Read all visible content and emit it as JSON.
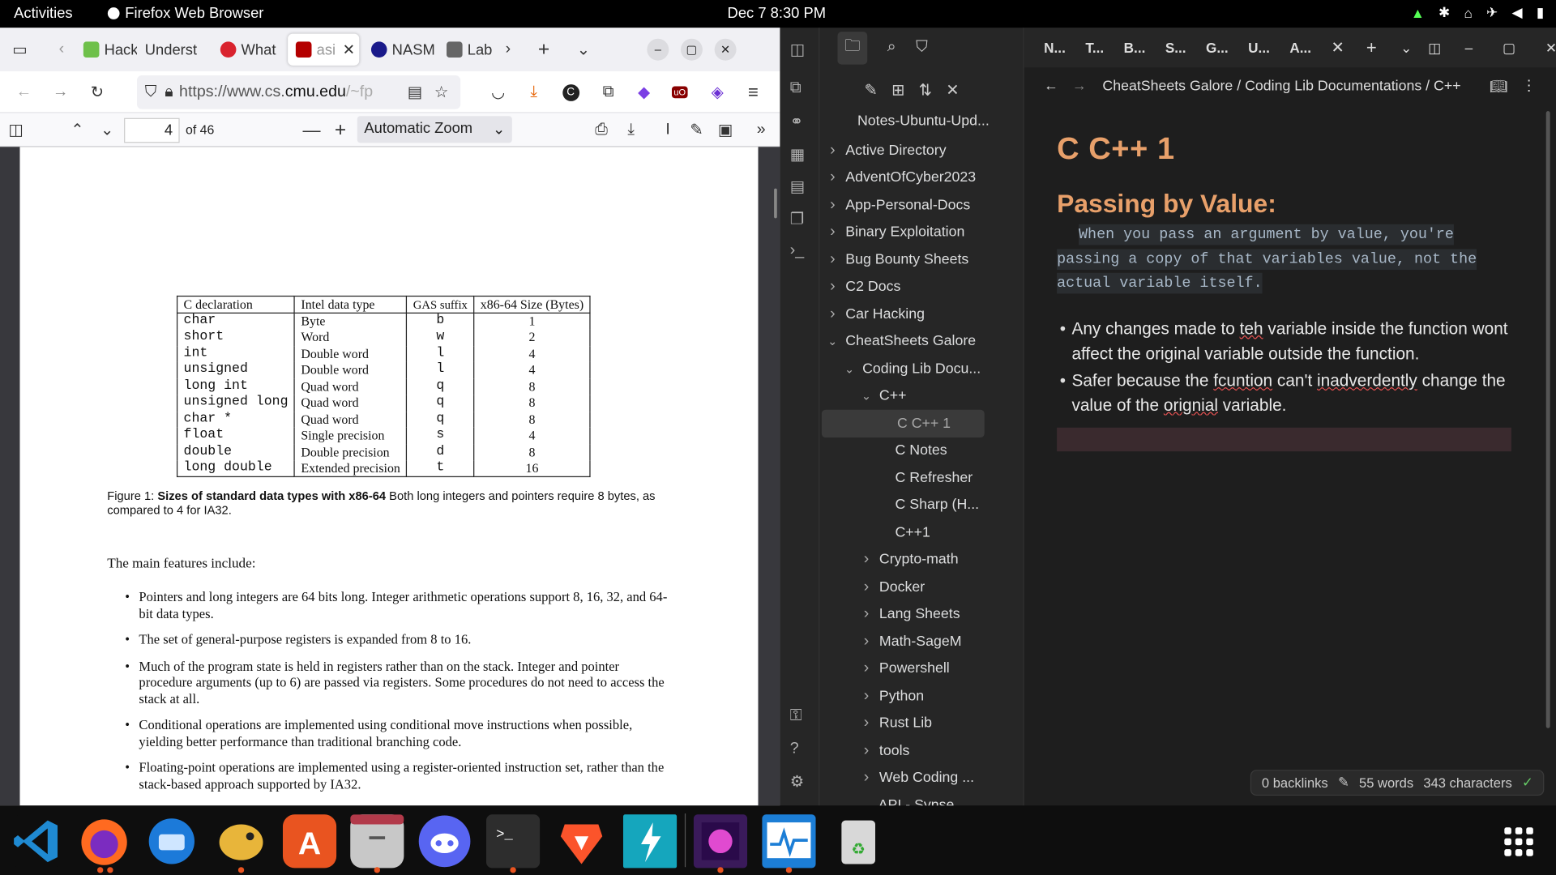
{
  "topbar": {
    "activities": "Activities",
    "app_name": "Firefox Web Browser",
    "clock": "Dec 7  8:30 PM"
  },
  "firefox": {
    "tabs": [
      {
        "label": "Hack",
        "icon_color": "#6ec04a"
      },
      {
        "label": "Underst",
        "icon_color": ""
      },
      {
        "label": "What",
        "icon_color": "#d9232e"
      },
      {
        "label": "asi",
        "icon_color": "#b40000"
      },
      {
        "label": "NASM",
        "icon_color": "#1a1a8a"
      },
      {
        "label": "Lab",
        "icon_color": "#555"
      }
    ],
    "url_prefix": "https://www.cs.",
    "url_domain": "cmu.edu",
    "url_suffix": "/~fp",
    "pdf": {
      "page_number": "4",
      "page_count": "of 46",
      "zoom": "Automatic Zoom"
    }
  },
  "pdf_content": {
    "table_headers": [
      "C declaration",
      "Intel data type",
      "GAS suffix",
      "x86-64 Size (Bytes)"
    ],
    "table_rows": [
      [
        "char",
        "Byte",
        "b",
        "1"
      ],
      [
        "short",
        "Word",
        "w",
        "2"
      ],
      [
        "int",
        "Double word",
        "l",
        "4"
      ],
      [
        "unsigned",
        "Double word",
        "l",
        "4"
      ],
      [
        "long int",
        "Quad word",
        "q",
        "8"
      ],
      [
        "unsigned long",
        "Quad word",
        "q",
        "8"
      ],
      [
        "char *",
        "Quad word",
        "q",
        "8"
      ],
      [
        "float",
        "Single precision",
        "s",
        "4"
      ],
      [
        "double",
        "Double precision",
        "d",
        "8"
      ],
      [
        "long double",
        "Extended precision",
        "t",
        "16"
      ]
    ],
    "caption_label": "Figure 1:",
    "caption_bold": "Sizes of standard data types with x86-64",
    "caption_text": "Both long integers and pointers require 8 bytes, as compared to 4 for IA32.",
    "features_intro": "The main features include:",
    "bullets": [
      "Pointers and long integers are 64 bits long. Integer arithmetic operations support 8, 16, 32, and 64-bit data types.",
      "The set of general-purpose registers is expanded from 8 to 16.",
      "Much of the program state is held in registers rather than on the stack. Integer and pointer procedure arguments (up to 6) are passed via registers. Some procedures do not need to access the stack at all.",
      "Conditional operations are implemented using conditional move instructions when possible, yielding better performance than traditional branching code.",
      "Floating-point operations are implemented using a register-oriented instruction set, rather than the stack-based approach supported by IA32."
    ]
  },
  "obsidian": {
    "vault_name": "Notes-Ubuntu-Upd...",
    "tree": [
      {
        "label": "Active Directory",
        "level": 0,
        "folder": true,
        "open": false
      },
      {
        "label": "AdventOfCyber2023",
        "level": 0,
        "folder": true,
        "open": false
      },
      {
        "label": "App-Personal-Docs",
        "level": 0,
        "folder": true,
        "open": false
      },
      {
        "label": "Binary Exploitation",
        "level": 0,
        "folder": true,
        "open": false
      },
      {
        "label": "Bug Bounty Sheets",
        "level": 0,
        "folder": true,
        "open": false
      },
      {
        "label": "C2 Docs",
        "level": 0,
        "folder": true,
        "open": false
      },
      {
        "label": "Car Hacking",
        "level": 0,
        "folder": true,
        "open": false
      },
      {
        "label": "CheatSheets Galore",
        "level": 0,
        "folder": true,
        "open": true
      },
      {
        "label": "Coding Lib Docu...",
        "level": 1,
        "folder": true,
        "open": true
      },
      {
        "label": "C++",
        "level": 2,
        "folder": true,
        "open": true
      },
      {
        "label": "C C++ 1",
        "level": 3,
        "folder": false,
        "selected": true
      },
      {
        "label": "C Notes",
        "level": 3,
        "folder": false
      },
      {
        "label": "C Refresher",
        "level": 3,
        "folder": false
      },
      {
        "label": "C Sharp (H...",
        "level": 3,
        "folder": false
      },
      {
        "label": "C++1",
        "level": 3,
        "folder": false
      },
      {
        "label": "Crypto-math",
        "level": 2,
        "folder": true,
        "open": false
      },
      {
        "label": "Docker",
        "level": 2,
        "folder": true,
        "open": false
      },
      {
        "label": "Lang Sheets",
        "level": 2,
        "folder": true,
        "open": false
      },
      {
        "label": "Math-SageM",
        "level": 2,
        "folder": true,
        "open": false
      },
      {
        "label": "Powershell",
        "level": 2,
        "folder": true,
        "open": false
      },
      {
        "label": "Python",
        "level": 2,
        "folder": true,
        "open": false
      },
      {
        "label": "Rust Lib",
        "level": 2,
        "folder": true,
        "open": false
      },
      {
        "label": "tools",
        "level": 2,
        "folder": true,
        "open": false
      },
      {
        "label": "Web Coding ...",
        "level": 2,
        "folder": true,
        "open": false
      },
      {
        "label": "API - Synse...",
        "level": 2,
        "folder": false
      }
    ],
    "editor_tabs": [
      "N...",
      "T...",
      "B...",
      "S...",
      "G...",
      "U...",
      "A..."
    ],
    "breadcrumb": [
      "CheatSheets Galore",
      "Coding Lib Documentations",
      "C++"
    ],
    "note_title": "C C++ 1",
    "heading": "Passing by Value:",
    "quote_lines": [
      "When you pass an argument by value, you're",
      "passing a copy of that variables value, not the",
      "actual variable itself."
    ],
    "bullet1": {
      "a": "Any changes made to ",
      "err": "teh",
      "b": " variable inside the function wont affect the original variable outside the function."
    },
    "bullet2": {
      "a": "Safer because the ",
      "err1": "fcuntion",
      "b": " can't ",
      "err2": "inadverdently",
      "c": " change the value of the ",
      "err3": "orignial",
      "d": " variable."
    },
    "status": {
      "backlinks": "0 backlinks",
      "words": "55 words",
      "chars": "343 characters"
    }
  },
  "dock": {
    "apps": [
      "vscode",
      "firefox",
      "thunderbird",
      "ghidra",
      "software-center",
      "files",
      "discord",
      "terminal",
      "brave",
      "tutanota",
      "cyberpunk-game",
      "system-monitor",
      "trash",
      "app-grid"
    ]
  }
}
